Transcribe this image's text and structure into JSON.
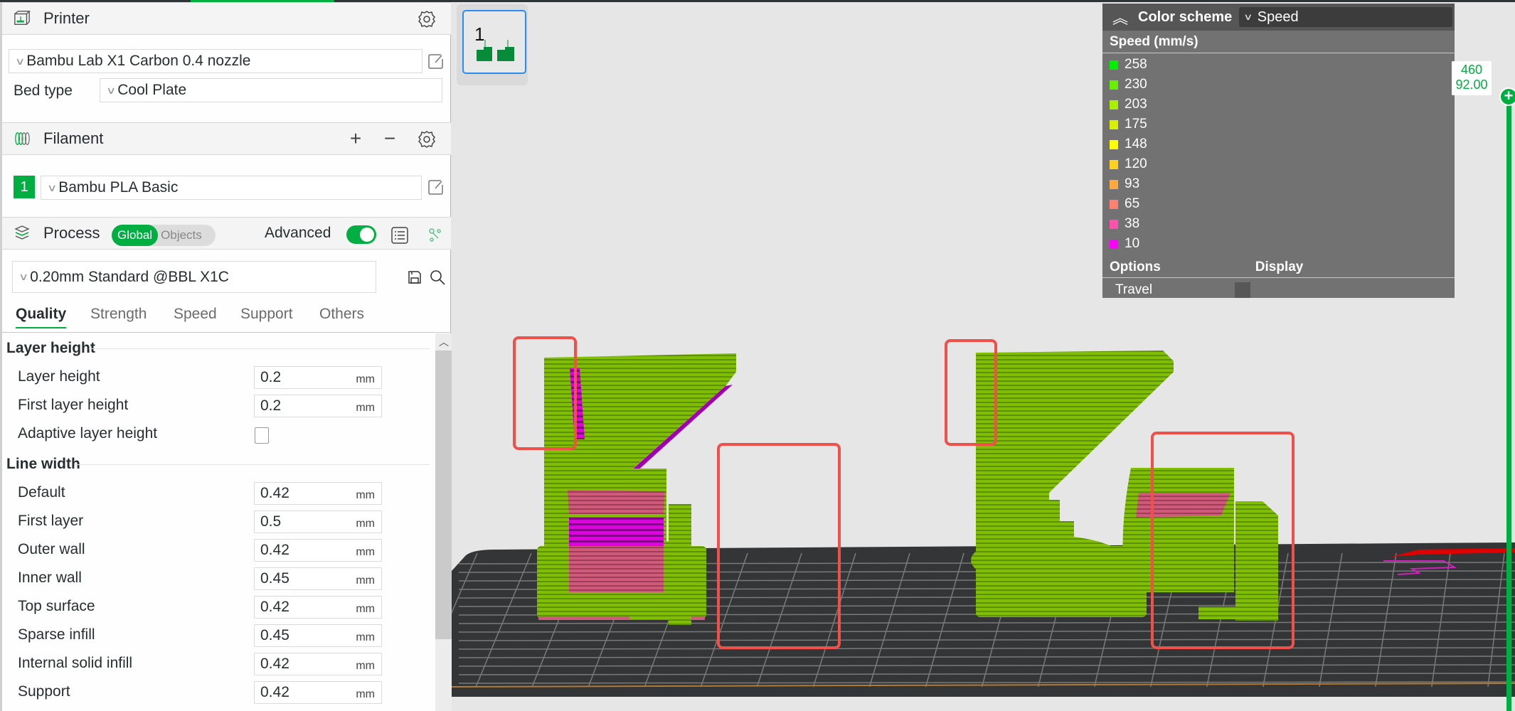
{
  "printer": {
    "title": "Printer",
    "preset": "Bambu Lab X1 Carbon 0.4 nozzle",
    "bed_type_label": "Bed type",
    "bed_type": "Cool Plate"
  },
  "filament": {
    "title": "Filament",
    "add_label": "+",
    "remove_label": "−",
    "slot_number": "1",
    "preset": "Bambu PLA Basic",
    "slot_color": "#00ae42"
  },
  "process": {
    "title": "Process",
    "scope_global": "Global",
    "scope_objects": "Objects",
    "advanced_label": "Advanced",
    "advanced_on": true,
    "preset": "0.20mm Standard @BBL X1C",
    "tabs": [
      {
        "label": "Quality",
        "active": true
      },
      {
        "label": "Strength",
        "active": false
      },
      {
        "label": "Speed",
        "active": false
      },
      {
        "label": "Support",
        "active": false
      },
      {
        "label": "Others",
        "active": false
      }
    ],
    "groups": {
      "layer_height": {
        "title": "Layer height",
        "layer_height": {
          "label": "Layer height",
          "value": "0.2",
          "unit": "mm"
        },
        "first_layer_height": {
          "label": "First layer height",
          "value": "0.2",
          "unit": "mm"
        },
        "adaptive": {
          "label": "Adaptive layer height",
          "checked": false
        }
      },
      "line_width": {
        "title": "Line width",
        "rows": [
          {
            "label": "Default",
            "value": "0.42",
            "unit": "mm"
          },
          {
            "label": "First layer",
            "value": "0.5",
            "unit": "mm"
          },
          {
            "label": "Outer wall",
            "value": "0.42",
            "unit": "mm"
          },
          {
            "label": "Inner wall",
            "value": "0.45",
            "unit": "mm"
          },
          {
            "label": "Top surface",
            "value": "0.42",
            "unit": "mm"
          },
          {
            "label": "Sparse infill",
            "value": "0.45",
            "unit": "mm"
          },
          {
            "label": "Internal solid infill",
            "value": "0.42",
            "unit": "mm"
          },
          {
            "label": "Support",
            "value": "0.42",
            "unit": "mm"
          }
        ]
      }
    }
  },
  "viewport": {
    "plate_number": "1",
    "legend": {
      "color_scheme_label": "Color scheme",
      "color_scheme_value": "Speed",
      "title": "Speed (mm/s)",
      "items": [
        {
          "value": "258",
          "color": "#00f000"
        },
        {
          "value": "230",
          "color": "#66f000"
        },
        {
          "value": "203",
          "color": "#a8f000"
        },
        {
          "value": "175",
          "color": "#d8f000"
        },
        {
          "value": "148",
          "color": "#ffff00"
        },
        {
          "value": "120",
          "color": "#ffd020"
        },
        {
          "value": "93",
          "color": "#ffa840"
        },
        {
          "value": "65",
          "color": "#ff8070"
        },
        {
          "value": "38",
          "color": "#ff50b0"
        },
        {
          "value": "10",
          "color": "#ff00ff"
        }
      ],
      "options_label": "Options",
      "display_label": "Display",
      "travel_label": "Travel",
      "travel_display": false
    },
    "layer_slider": {
      "layer": "460",
      "height": "92.00"
    },
    "colors": {
      "accent": "#00ae42",
      "highlight_box": "#f0504a",
      "model_green": "#7fc000",
      "bed": "#333536"
    }
  }
}
